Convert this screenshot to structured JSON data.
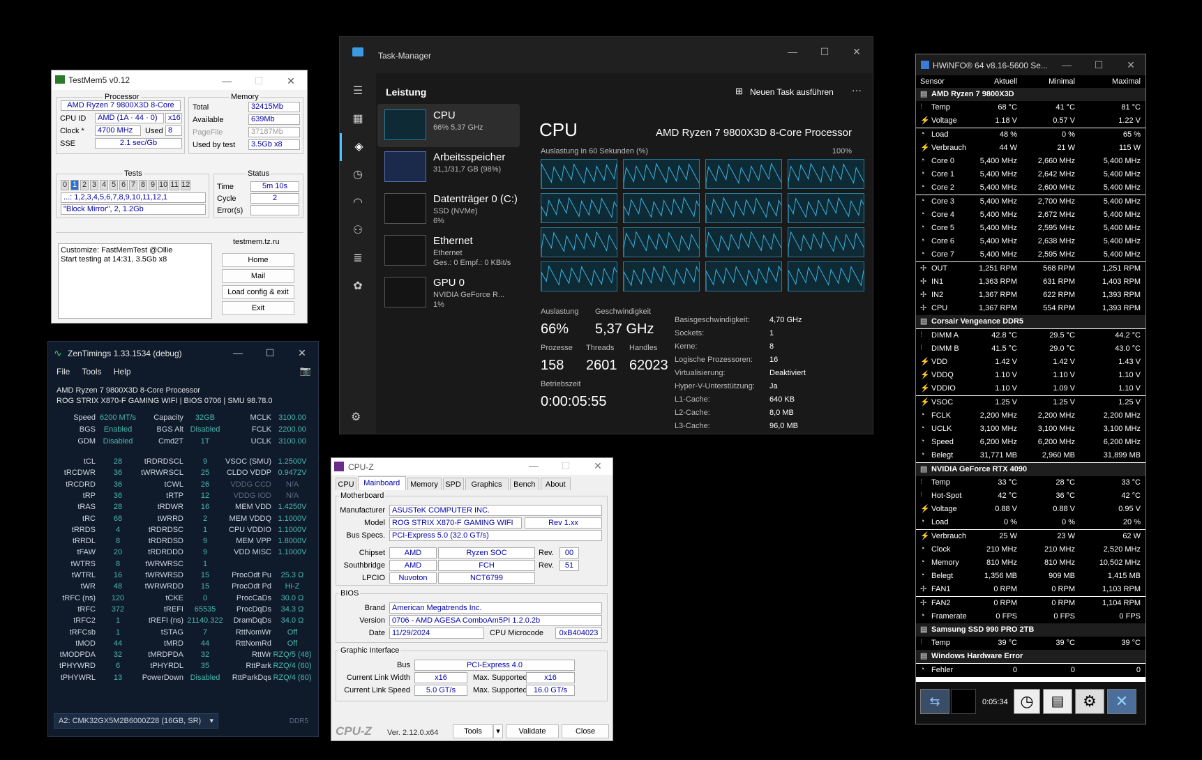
{
  "testmem": {
    "title": "TestMem5 v0.12",
    "processor_label": "Processor",
    "processor": "AMD Ryzen 7 9800X3D 8-Core",
    "cpuid_label": "CPU ID",
    "cpuid": "AMD  (1A · 44 · 0)",
    "cpuid_x": "x16",
    "clock_label": "Clock *",
    "clock": "4700 MHz",
    "used_label": "Used",
    "used": "8",
    "sse_label": "SSE",
    "sse": "2.1 sec/Gb",
    "memory_label": "Memory",
    "total_label": "Total",
    "total": "32415Mb",
    "avail_label": "Available",
    "avail": "639Mb",
    "pagefile_label": "PageFile",
    "pagefile": "37187Mb",
    "usedby_label": "Used by test",
    "usedby": "3.5Gb x8",
    "tests_label": "Tests",
    "tests": [
      "0",
      "1",
      "2",
      "3",
      "4",
      "5",
      "6",
      "7",
      "8",
      "9",
      "10",
      "11",
      "12"
    ],
    "active_test": 1,
    "seq": "...: 1,2,3,4,5,6,7,8,9,10,11,12,1",
    "mode": "\"Block Mirror\", 2, 1.2Gb",
    "status_label": "Status",
    "time_label": "Time",
    "time": "5m 10s",
    "cycle_label": "Cycle",
    "cycle": "2",
    "errors_label": "Error(s)",
    "errors": "",
    "site": "testmem.tz.ru",
    "log1": "Customize: FastMemTest @Ollie",
    "log2": "Start testing at 14:31, 3.5Gb x8",
    "btn_home": "Home",
    "btn_mail": "Mail",
    "btn_load": "Load config & exit",
    "btn_exit": "Exit"
  },
  "tm": {
    "title": "Task-Manager",
    "section": "Leistung",
    "new_task": "Neuen Task ausführen",
    "more": "···",
    "items": [
      {
        "name": "CPU",
        "sub1": "66% 5,37 GHz",
        "sub2": "",
        "sub3": ""
      },
      {
        "name": "Arbeitsspeicher",
        "sub1": "31,1/31,7 GB (98%)",
        "sub2": "",
        "sub3": ""
      },
      {
        "name": "Datenträger 0 (C:)",
        "sub1": "SSD (NVMe)",
        "sub2": "6%",
        "sub3": ""
      },
      {
        "name": "Ethernet",
        "sub1": "Ethernet",
        "sub2": "Ges.: 0 Empf.: 0 KBit/s",
        "sub3": ""
      },
      {
        "name": "GPU 0",
        "sub1": "NVIDIA GeForce R...",
        "sub2": "1%",
        "sub3": ""
      }
    ],
    "heading": "CPU",
    "cpu_name": "AMD Ryzen 7 9800X3D 8-Core Processor",
    "graph_label": "Auslastung in 60 Sekunden (%)",
    "graph_max": "100%",
    "util_label": "Auslastung",
    "util": "66%",
    "speed_label": "Geschwindigkeit",
    "speed": "5,37 GHz",
    "proc_label": "Prozesse",
    "proc": "158",
    "threads_label": "Threads",
    "threads": "2601",
    "handles_label": "Handles",
    "handles": "62023",
    "uptime_label": "Betriebszeit",
    "uptime": "0:00:05:55",
    "props": [
      {
        "k": "Basisgeschwindigkeit:",
        "v": "4,70 GHz"
      },
      {
        "k": "Sockets:",
        "v": "1"
      },
      {
        "k": "Kerne:",
        "v": "8"
      },
      {
        "k": "Logische Prozessoren:",
        "v": "16"
      },
      {
        "k": "Virtualisierung:",
        "v": "Deaktiviert"
      },
      {
        "k": "Hyper-V-Unterstützung:",
        "v": "Ja"
      },
      {
        "k": "L1-Cache:",
        "v": "640 KB"
      },
      {
        "k": "L2-Cache:",
        "v": "8,0 MB"
      },
      {
        "k": "L3-Cache:",
        "v": "96,0 MB"
      }
    ]
  },
  "hw": {
    "title": "HWiNFO® 64 v8.16-5600 Se...",
    "cols": [
      "Sensor",
      "Aktuell",
      "Minimal",
      "Maximal"
    ],
    "elapsed": "0:05:34",
    "rows": [
      {
        "g": true,
        "n": "AMD Ryzen 7 9800X3D"
      },
      {
        "i": "t",
        "n": "Temp",
        "a": "68 °C",
        "mi": "41 °C",
        "ma": "81 °C"
      },
      {
        "i": "v",
        "n": "Voltage",
        "a": "1.18 V",
        "mi": "0.57 V",
        "ma": "1.22 V"
      },
      {
        "i": "c",
        "n": "Load",
        "a": "48 %",
        "mi": "0 %",
        "ma": "65 %"
      },
      {
        "i": "v",
        "n": "Verbrauch",
        "a": "44 W",
        "mi": "21 W",
        "ma": "115 W"
      },
      {
        "i": "c",
        "n": "Core 0",
        "a": "5,400 MHz",
        "mi": "2,660 MHz",
        "ma": "5,400 MHz"
      },
      {
        "i": "c",
        "n": "Core 1",
        "a": "5,400 MHz",
        "mi": "2,642 MHz",
        "ma": "5,400 MHz"
      },
      {
        "i": "c",
        "n": "Core 2",
        "a": "5,400 MHz",
        "mi": "2,600 MHz",
        "ma": "5,400 MHz"
      },
      {
        "i": "c",
        "n": "Core 3",
        "a": "5,400 MHz",
        "mi": "2,700 MHz",
        "ma": "5,400 MHz"
      },
      {
        "i": "c",
        "n": "Core 4",
        "a": "5,400 MHz",
        "mi": "2,672 MHz",
        "ma": "5,400 MHz"
      },
      {
        "i": "c",
        "n": "Core 5",
        "a": "5,400 MHz",
        "mi": "2,595 MHz",
        "ma": "5,400 MHz"
      },
      {
        "i": "c",
        "n": "Core 6",
        "a": "5,400 MHz",
        "mi": "2,638 MHz",
        "ma": "5,400 MHz"
      },
      {
        "i": "c",
        "n": "Core 7",
        "a": "5,400 MHz",
        "mi": "2,595 MHz",
        "ma": "5,400 MHz"
      },
      {
        "i": "f",
        "n": "OUT",
        "a": "1,251 RPM",
        "mi": "568 RPM",
        "ma": "1,251 RPM"
      },
      {
        "i": "f",
        "n": "IN1",
        "a": "1,363 RPM",
        "mi": "631 RPM",
        "ma": "1,403 RPM"
      },
      {
        "i": "f",
        "n": "IN2",
        "a": "1,367 RPM",
        "mi": "622 RPM",
        "ma": "1,393 RPM"
      },
      {
        "i": "f",
        "n": "CPU",
        "a": "1,367 RPM",
        "mi": "554 RPM",
        "ma": "1,393 RPM"
      },
      {
        "g": true,
        "n": "Corsair Vengeance DDR5"
      },
      {
        "i": "t",
        "n": "DIMM A",
        "a": "42.8 °C",
        "mi": "29.5 °C",
        "ma": "44.2 °C"
      },
      {
        "i": "t",
        "n": "DIMM B",
        "a": "41.5 °C",
        "mi": "29.0 °C",
        "ma": "43.0 °C"
      },
      {
        "i": "v",
        "n": "VDD",
        "a": "1.42 V",
        "mi": "1.42 V",
        "ma": "1.43 V"
      },
      {
        "i": "v",
        "n": "VDDQ",
        "a": "1.10 V",
        "mi": "1.10 V",
        "ma": "1.10 V"
      },
      {
        "i": "v",
        "n": "VDDIO",
        "a": "1.10 V",
        "mi": "1.09 V",
        "ma": "1.10 V"
      },
      {
        "i": "v",
        "n": "VSOC",
        "a": "1.25 V",
        "mi": "1.25 V",
        "ma": "1.25 V"
      },
      {
        "i": "c",
        "n": "FCLK",
        "a": "2,200 MHz",
        "mi": "2,200 MHz",
        "ma": "2,200 MHz"
      },
      {
        "i": "c",
        "n": "UCLK",
        "a": "3,100 MHz",
        "mi": "3,100 MHz",
        "ma": "3,100 MHz"
      },
      {
        "i": "c",
        "n": "Speed",
        "a": "6,200 MHz",
        "mi": "6,200 MHz",
        "ma": "6,200 MHz"
      },
      {
        "i": "c",
        "n": "Belegt",
        "a": "31,771 MB",
        "mi": "2,960 MB",
        "ma": "31,899 MB"
      },
      {
        "g": true,
        "n": "NVIDIA GeForce RTX 4090"
      },
      {
        "i": "t",
        "n": "Temp",
        "a": "33 °C",
        "mi": "28 °C",
        "ma": "33 °C"
      },
      {
        "i": "t",
        "n": "Hot-Spot",
        "a": "42 °C",
        "mi": "36 °C",
        "ma": "42 °C"
      },
      {
        "i": "v",
        "n": "Voltage",
        "a": "0.88 V",
        "mi": "0.88 V",
        "ma": "0.95 V"
      },
      {
        "i": "c",
        "n": "Load",
        "a": "0 %",
        "mi": "0 %",
        "ma": "20 %"
      },
      {
        "i": "v",
        "n": "Verbrauch",
        "a": "25 W",
        "mi": "23 W",
        "ma": "62 W"
      },
      {
        "i": "c",
        "n": "Clock",
        "a": "210 MHz",
        "mi": "210 MHz",
        "ma": "2,520 MHz"
      },
      {
        "i": "c",
        "n": "Memory",
        "a": "810 MHz",
        "mi": "810 MHz",
        "ma": "10,502 MHz"
      },
      {
        "i": "c",
        "n": "Belegt",
        "a": "1,356 MB",
        "mi": "909 MB",
        "ma": "1,415 MB"
      },
      {
        "i": "f",
        "n": "FAN1",
        "a": "0 RPM",
        "mi": "0 RPM",
        "ma": "1,103 RPM"
      },
      {
        "i": "f",
        "n": "FAN2",
        "a": "0 RPM",
        "mi": "0 RPM",
        "ma": "1,104 RPM"
      },
      {
        "i": "c",
        "n": "Framerate",
        "a": "0 FPS",
        "mi": "0 FPS",
        "ma": "0 FPS"
      },
      {
        "g": true,
        "n": "Samsung SSD 990 PRO 2TB"
      },
      {
        "i": "t",
        "n": "Temp",
        "a": "39 °C",
        "mi": "39 °C",
        "ma": "39 °C"
      },
      {
        "g": true,
        "n": "Windows Hardware Error"
      },
      {
        "i": "c",
        "n": "Fehler",
        "a": "0",
        "mi": "0",
        "ma": "0"
      }
    ]
  },
  "zt": {
    "title": "ZenTimings 1.33.1534 (debug)",
    "menu": [
      "File",
      "Tools",
      "Help"
    ],
    "cpu": "AMD Ryzen 7 9800X3D 8-Core Processor",
    "board": "ROG STRIX X870-F GAMING WIFI | BIOS 0706 | SMU 98.78.0",
    "top": [
      [
        "Speed",
        "6200 MT/s",
        "Capacity",
        "32GB",
        "MCLK",
        "3100.00"
      ],
      [
        "BGS",
        "Enabled",
        "BGS Alt",
        "Disabled",
        "FCLK",
        "2200.00"
      ],
      [
        "GDM",
        "Disabled",
        "Cmd2T",
        "1T",
        "UCLK",
        "3100.00"
      ]
    ],
    "rows": [
      [
        "tCL",
        "28",
        "tRDRDSCL",
        "9",
        "VSOC (SMU)",
        "1.2500V"
      ],
      [
        "tRCDWR",
        "36",
        "tWRWRSCL",
        "25",
        "CLDO VDDP",
        "0.9472V"
      ],
      [
        "tRCDRD",
        "36",
        "tCWL",
        "26",
        "VDDG CCD",
        "N/A"
      ],
      [
        "tRP",
        "36",
        "tRTP",
        "12",
        "VDDG IOD",
        "N/A"
      ],
      [
        "tRAS",
        "28",
        "tRDWR",
        "16",
        "MEM VDD",
        "1.4250V"
      ],
      [
        "tRC",
        "68",
        "tWRRD",
        "2",
        "MEM VDDQ",
        "1.1000V"
      ],
      [
        "tRRDS",
        "4",
        "tRDRDSC",
        "1",
        "CPU VDDIO",
        "1.1000V"
      ],
      [
        "tRRDL",
        "8",
        "tRDRDSD",
        "9",
        "MEM VPP",
        "1.8000V"
      ],
      [
        "tFAW",
        "20",
        "tRDRDDD",
        "9",
        "VDD MISC",
        "1.1000V"
      ],
      [
        "tWTRS",
        "8",
        "tWRWRSC",
        "1",
        "",
        ""
      ],
      [
        "tWTRL",
        "16",
        "tWRWRSD",
        "15",
        "ProcOdt Pu",
        "25.3 Ω"
      ],
      [
        "tWR",
        "48",
        "tWRWRDD",
        "15",
        "ProcOdt Pd",
        "Hi-Z"
      ],
      [
        "tRFC (ns)",
        "120",
        "tCKE",
        "0",
        "ProcCaDs",
        "30.0 Ω"
      ],
      [
        "tRFC",
        "372",
        "tREFI",
        "65535",
        "ProcDqDs",
        "34.3 Ω"
      ],
      [
        "tRFC2",
        "1",
        "tREFI (ns)",
        "21140.322",
        "DramDqDs",
        "34.0 Ω"
      ],
      [
        "tRFCsb",
        "1",
        "tSTAG",
        "7",
        "RttNomWr",
        "Off"
      ],
      [
        "tMOD",
        "44",
        "tMRD",
        "44",
        "RttNomRd",
        "Off"
      ],
      [
        "tMODPDA",
        "32",
        "tMRDPDA",
        "32",
        "RttWr",
        "RZQ/5 (48)"
      ],
      [
        "tPHYWRD",
        "6",
        "tPHYRDL",
        "35",
        "RttPark",
        "RZQ/4 (60)"
      ],
      [
        "tPHYWRL",
        "13",
        "PowerDown",
        "Disabled",
        "RttParkDqs",
        "RZQ/4 (60)"
      ]
    ],
    "module": "A2: CMK32GX5M2B6000Z28 (16GB, SR)",
    "ddr": "DDR5"
  },
  "cz": {
    "title": "CPU-Z",
    "tabs": [
      "CPU",
      "Mainboard",
      "Memory",
      "SPD",
      "Graphics",
      "Bench",
      "About"
    ],
    "active_tab": 1,
    "mb_label": "Motherboard",
    "man_label": "Manufacturer",
    "man": "ASUSTeK COMPUTER INC.",
    "model_label": "Model",
    "model": "ROG STRIX X870-F GAMING WIFI",
    "rev_model": "Rev 1.xx",
    "bus_label": "Bus Specs.",
    "bus": "PCI-Express 5.0 (32.0 GT/s)",
    "chipset_label": "Chipset",
    "chipset": "AMD",
    "chipset2": "Ryzen SOC",
    "rev_label": "Rev.",
    "chipset_rev": "00",
    "sb_label": "Southbridge",
    "sb": "AMD",
    "sb2": "FCH",
    "sb_rev": "51",
    "lpcio_label": "LPCIO",
    "lpcio": "Nuvoton",
    "lpcio2": "NCT6799",
    "bios_label": "BIOS",
    "brand_label": "Brand",
    "brand": "American Megatrends Inc.",
    "ver_label": "Version",
    "ver": "0706 - AMD AGESA ComboAm5PI 1.2.0.2b",
    "date_label": "Date",
    "date": "11/29/2024",
    "micro_label": "CPU Microcode",
    "micro": "0xB404023",
    "gi_label": "Graphic Interface",
    "gbus_label": "Bus",
    "gbus": "PCI-Express 4.0",
    "clw_label": "Current Link Width",
    "clw": "x16",
    "mlw_label": "Max. Supported",
    "mlw": "x16",
    "cls_label": "Current Link Speed",
    "cls": "5.0 GT/s",
    "mls_label": "Max. Supported",
    "mls": "16.0 GT/s",
    "logo": "CPU-Z",
    "version": "Ver. 2.12.0.x64",
    "btn_tools": "Tools",
    "btn_validate": "Validate",
    "btn_close": "Close"
  }
}
